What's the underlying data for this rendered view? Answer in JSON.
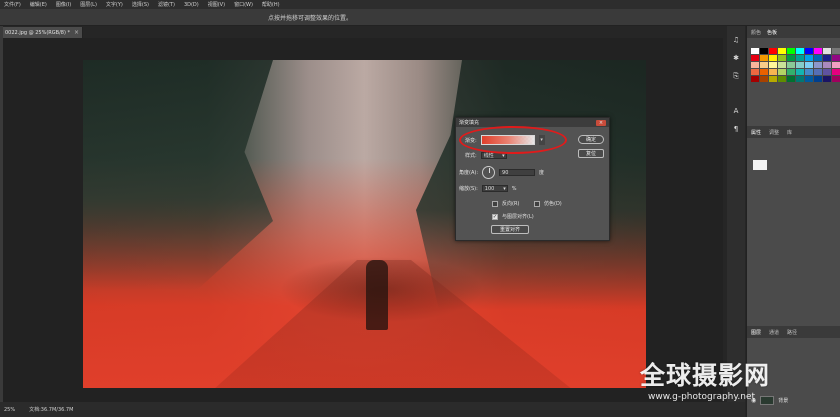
{
  "menu": [
    "文件(F)",
    "编辑(E)",
    "图像(I)",
    "图层(L)",
    "文字(Y)",
    "选择(S)",
    "滤镜(T)",
    "3D(D)",
    "视图(V)",
    "窗口(W)",
    "帮助(H)"
  ],
  "options_hint": "点按并拖移可调整效果的位置。",
  "document_tab": {
    "title": "0022.jpg @ 25%(RGB/8) *",
    "close": "×"
  },
  "dialog": {
    "title": "渐变填充",
    "close": "×",
    "gradient_label": "渐变:",
    "style_label": "样式:",
    "style_value": "线性",
    "angle_label": "角度(A):",
    "angle_value": "90",
    "angle_unit": "度",
    "scale_label": "缩放(S):",
    "scale_value": "100",
    "scale_unit": "%",
    "reverse_label": "反向(R)",
    "dither_label": "仿色(D)",
    "align_label": "与图层对齐(L)",
    "reset_align_label": "重置对齐",
    "ok_label": "确定",
    "cancel_label": "复位",
    "reverse_checked": false,
    "dither_checked": false,
    "align_checked": true
  },
  "status": {
    "zoom": "25%",
    "doc_info": "文档:36.7M/36.7M"
  },
  "right_panel": {
    "top_tabs": [
      "颜色",
      "色板"
    ],
    "properties_tabs": [
      "属性",
      "调整",
      "库"
    ],
    "layers_tabs": [
      "图层",
      "通道",
      "路径"
    ],
    "layer_name": "背景",
    "swatch_colors": [
      "#ffffff",
      "#000000",
      "#ff0000",
      "#ffff00",
      "#00ff00",
      "#00ffff",
      "#0000ff",
      "#ff00ff",
      "#e0e0e0",
      "#777777",
      "#e60012",
      "#f39800",
      "#fff100",
      "#8fc31f",
      "#009944",
      "#009e96",
      "#00a0e9",
      "#0068b7",
      "#1d2088",
      "#920783",
      "#f8b59c",
      "#facd89",
      "#fff799",
      "#cce198",
      "#89c997",
      "#84ccc9",
      "#7ecef4",
      "#8c97cb",
      "#aa89bd",
      "#f19ec2",
      "#ec6941",
      "#eb6100",
      "#f8b551",
      "#b3d465",
      "#32b16c",
      "#13b5b1",
      "#448aca",
      "#556fb5",
      "#5f52a0",
      "#e4007f",
      "#a40000",
      "#a84200",
      "#b7aa00",
      "#5f8d00",
      "#007130",
      "#007874",
      "#005aa0",
      "#003f8e",
      "#1b1464",
      "#a0005e"
    ]
  },
  "watermark": {
    "title": "全球摄影网",
    "url": "www.g-photography.net"
  }
}
